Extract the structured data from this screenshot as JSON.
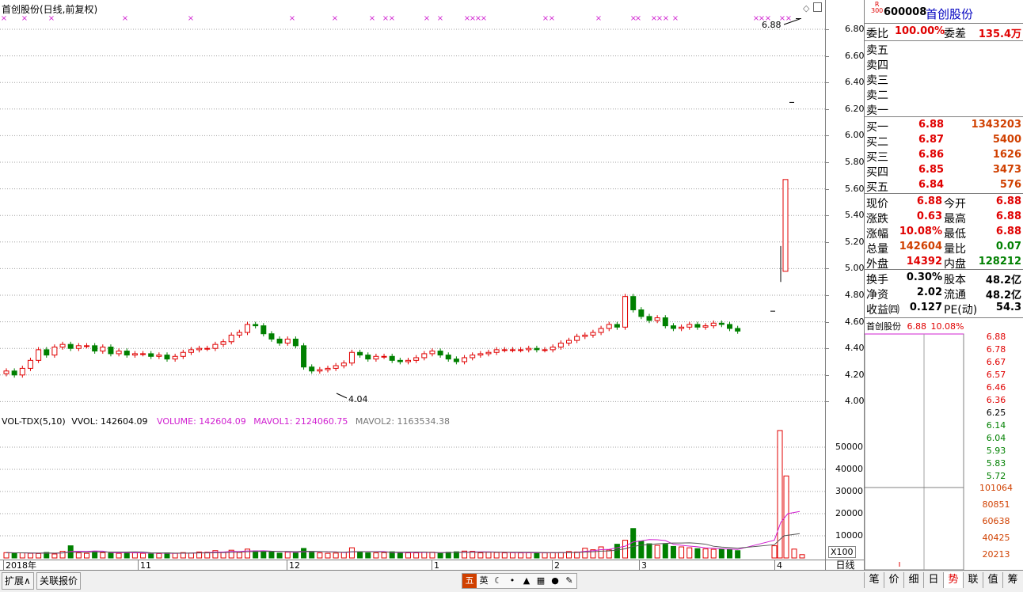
{
  "chart_title": "首创股份(日线,前复权)",
  "price_axis": [
    "6.80",
    "6.60",
    "6.40",
    "6.20",
    "6.00",
    "5.80",
    "5.60",
    "5.40",
    "5.20",
    "5.00",
    "4.80",
    "4.60",
    "4.40",
    "4.20",
    "4.00"
  ],
  "annotations": {
    "high_label": "6.88",
    "low_label": "4.04"
  },
  "vol_header": {
    "name": "VOL-TDX(5,10)",
    "vvol": "VVOL: 142604.09",
    "volume": "VOLUME: 142604.09",
    "mavol1": "MAVOL1: 2124060.75",
    "mavol2": "MAVOL2: 1163534.38"
  },
  "vol_axis": [
    "50000",
    "40000",
    "30000",
    "20000",
    "10000"
  ],
  "vol_unit": "X100",
  "time_axis": [
    "2018年",
    "11",
    "12",
    "1",
    "2",
    "3",
    "4"
  ],
  "period_label": "日线",
  "stock": {
    "badge_top": "R",
    "badge_bottom": "300",
    "code": "600008",
    "name": "首创股份"
  },
  "weibi": {
    "label": "委比",
    "value": "100.00%",
    "diff_label": "委差",
    "diff_value": "135.4万"
  },
  "sell_levels": [
    {
      "label": "卖五"
    },
    {
      "label": "卖四"
    },
    {
      "label": "卖三"
    },
    {
      "label": "卖二"
    },
    {
      "label": "卖一"
    }
  ],
  "buy_levels": [
    {
      "label": "买一",
      "price": "6.88",
      "volume": "1343203"
    },
    {
      "label": "买二",
      "price": "6.87",
      "volume": "5400"
    },
    {
      "label": "买三",
      "price": "6.86",
      "volume": "1626"
    },
    {
      "label": "买四",
      "price": "6.85",
      "volume": "3473"
    },
    {
      "label": "买五",
      "price": "6.84",
      "volume": "576"
    }
  ],
  "quote": [
    {
      "l1": "现价",
      "v1": "6.88",
      "c1": "red",
      "l2": "今开",
      "v2": "6.88",
      "c2": "red"
    },
    {
      "l1": "涨跌",
      "v1": "0.63",
      "c1": "red",
      "l2": "最高",
      "v2": "6.88",
      "c2": "red"
    },
    {
      "l1": "涨幅",
      "v1": "10.08%",
      "c1": "red",
      "l2": "最低",
      "v2": "6.88",
      "c2": "red"
    },
    {
      "l1": "总量",
      "v1": "142604",
      "c1": "orange",
      "l2": "量比",
      "v2": "0.07",
      "c2": "green"
    },
    {
      "l1": "外盘",
      "v1": "14392",
      "c1": "red",
      "l2": "内盘",
      "v2": "128212",
      "c2": "green"
    }
  ],
  "finance": [
    {
      "l1": "换手",
      "v1": "0.30%",
      "l2": "股本",
      "v2": "48.2亿"
    },
    {
      "l1": "净资",
      "v1": "2.02",
      "l2": "流通",
      "v2": "48.2亿"
    },
    {
      "l1": "收益㈣",
      "v1": "0.127",
      "l2": "PE(动)",
      "v2": "54.3"
    }
  ],
  "mini": {
    "name": "首创股份",
    "price": "6.88",
    "pct": "10.08%",
    "price_axis": [
      "6.88",
      "6.78",
      "6.67",
      "6.57",
      "6.46",
      "6.36",
      "6.25",
      "6.14",
      "6.04",
      "5.93",
      "5.83",
      "5.72"
    ],
    "vol_axis": [
      "101064",
      "80851",
      "60638",
      "40425",
      "20213"
    ]
  },
  "left_tabs": [
    "扩展∧",
    "关联报价"
  ],
  "toolbar_icons": [
    "五",
    "英",
    "moon-icon",
    "dot-icon",
    "shirt-icon",
    "keyboard-icon",
    "user-icon",
    "wrench-icon"
  ],
  "right_tabs": [
    "笔",
    "价",
    "细",
    "日",
    "势",
    "联",
    "值",
    "筹"
  ],
  "right_tab_active": "势",
  "colors": {
    "up": "#e00000",
    "down": "#008000",
    "magenta": "#d020d0",
    "grid": "#a0a0a0"
  }
}
